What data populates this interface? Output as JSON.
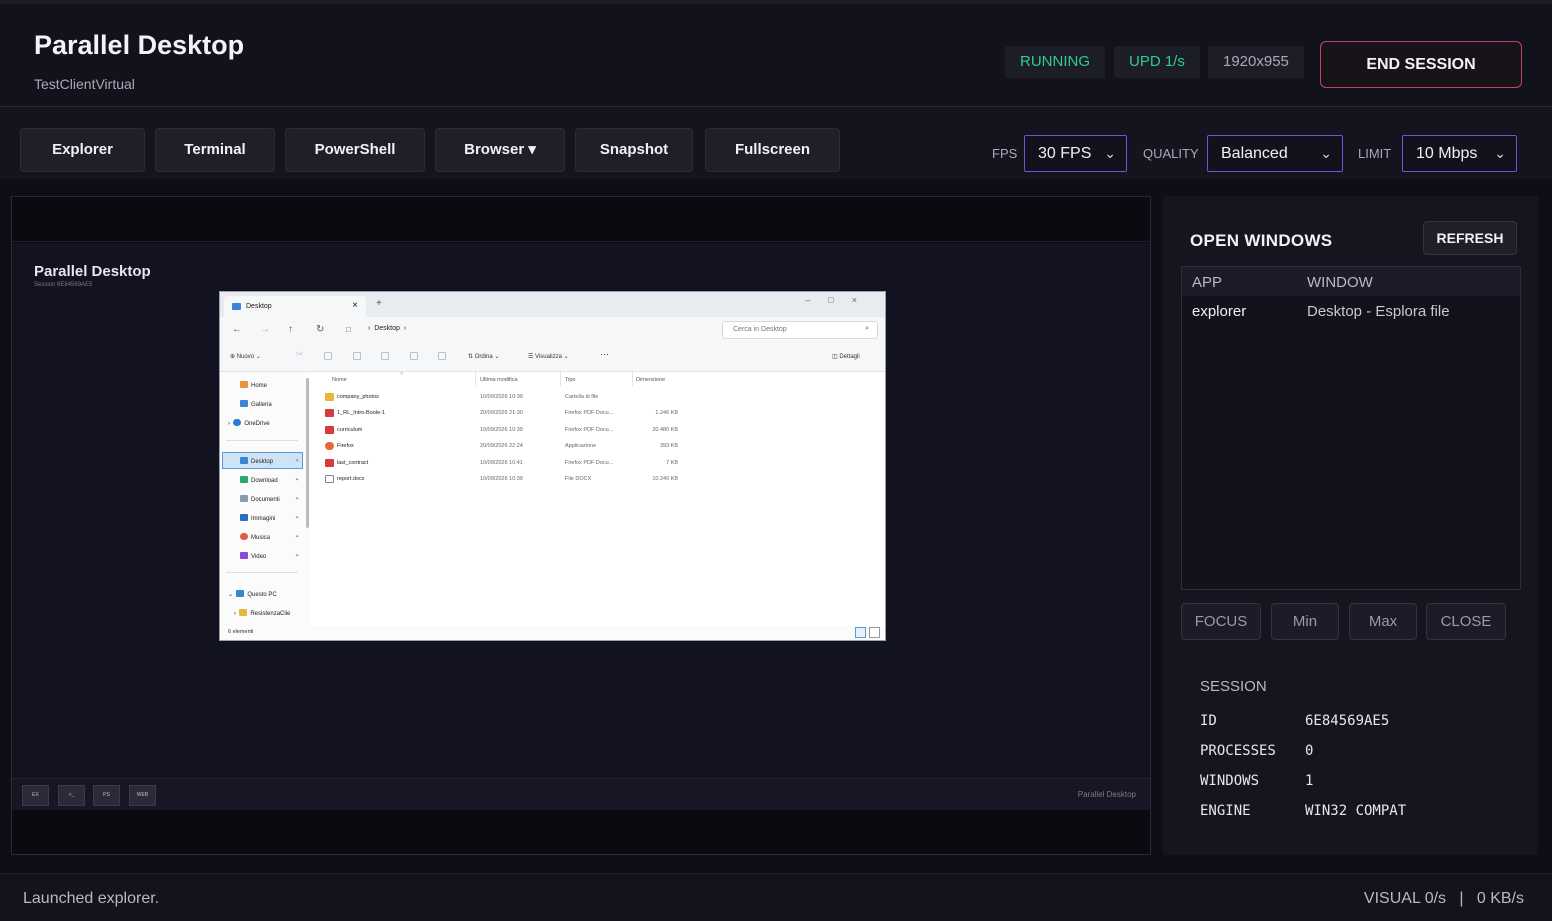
{
  "header": {
    "title": "Parallel Desktop",
    "subtitle": "TestClientVirtual",
    "status": "RUNNING",
    "update_rate": "UPD 1/s",
    "resolution": "1920x955",
    "end_session": "END SESSION",
    "accent_color": "#2ecc8f",
    "danger_color": "#c0475a"
  },
  "toolbar": {
    "buttons": [
      "Explorer",
      "Terminal",
      "PowerShell",
      "Browser ▾",
      "Snapshot",
      "Fullscreen"
    ],
    "fps_label": "FPS",
    "fps_value": "30 FPS",
    "quality_label": "QUALITY",
    "quality_value": "Balanced",
    "limit_label": "LIMIT",
    "limit_value": "10 Mbps",
    "select_border_color": "#7a4fd6"
  },
  "viewer": {
    "title": "Parallel Desktop",
    "session": "Session 6E84569AE5",
    "taskbar_icons": [
      "EX",
      ">_",
      "PS",
      "WEB"
    ],
    "taskbar_right": "Parallel Desktop",
    "explorer": {
      "tab": "Desktop",
      "breadcrumb": "Desktop",
      "search_placeholder": "Cerca in Desktop",
      "cmd": {
        "new": "Nuovo",
        "sort": "Ordina",
        "view": "Visualizza",
        "more": "···",
        "details": "Dettagli"
      },
      "nav": {
        "home": "Home",
        "gallery": "Galleria",
        "onedrive": "OneDrive",
        "desktop": "Desktop",
        "download": "Download",
        "documents": "Documenti",
        "images": "Immagini",
        "music": "Musica",
        "video": "Video",
        "thispc": "Questo PC",
        "resistenza": "ResistenzaClie"
      },
      "columns": {
        "name": "Nome",
        "modified": "Ultima modifica",
        "type": "Tipo",
        "size": "Dimensione"
      },
      "files": [
        {
          "name": "company_photos",
          "modified": "10/09/2026 10:39",
          "type": "Cartella di file",
          "size": "",
          "icon": "folder-icon"
        },
        {
          "name": "1_RL_Intro-Boole-1",
          "modified": "20/09/2026 21:30",
          "type": "Firefox PDF Docu...",
          "size": "1.246 KB",
          "icon": "pdf-icon"
        },
        {
          "name": "curriculum",
          "modified": "10/09/2026 10:39",
          "type": "Firefox PDF Docu...",
          "size": "20.480 KB",
          "icon": "pdf-icon"
        },
        {
          "name": "Firefox",
          "modified": "20/09/2026 22:24",
          "type": "Applicazione",
          "size": "393 KB",
          "icon": "firefox-icon"
        },
        {
          "name": "last_contract",
          "modified": "10/09/2026 10:41",
          "type": "Firefox PDF Docu...",
          "size": "7 KB",
          "icon": "pdf-icon"
        },
        {
          "name": "report.docx",
          "modified": "10/09/2026 10:39",
          "type": "File DOCX",
          "size": "10.240 KB",
          "icon": "document-icon"
        }
      ],
      "status": "6 elementi"
    }
  },
  "panel": {
    "title": "OPEN WINDOWS",
    "refresh": "REFRESH",
    "col_app": "APP",
    "col_window": "WINDOW",
    "rows": [
      {
        "app": "explorer",
        "window": "Desktop - Esplora file"
      }
    ],
    "actions": [
      "FOCUS",
      "Min",
      "Max",
      "CLOSE"
    ],
    "session_title": "SESSION",
    "session": [
      {
        "key": "ID",
        "value": "6E84569AE5"
      },
      {
        "key": "PROCESSES",
        "value": "0"
      },
      {
        "key": "WINDOWS",
        "value": "1"
      },
      {
        "key": "ENGINE",
        "value": "WIN32 COMPAT"
      }
    ]
  },
  "statusbar": {
    "message": "Launched explorer.",
    "right": "VISUAL 0/s   |   0 KB/s"
  }
}
